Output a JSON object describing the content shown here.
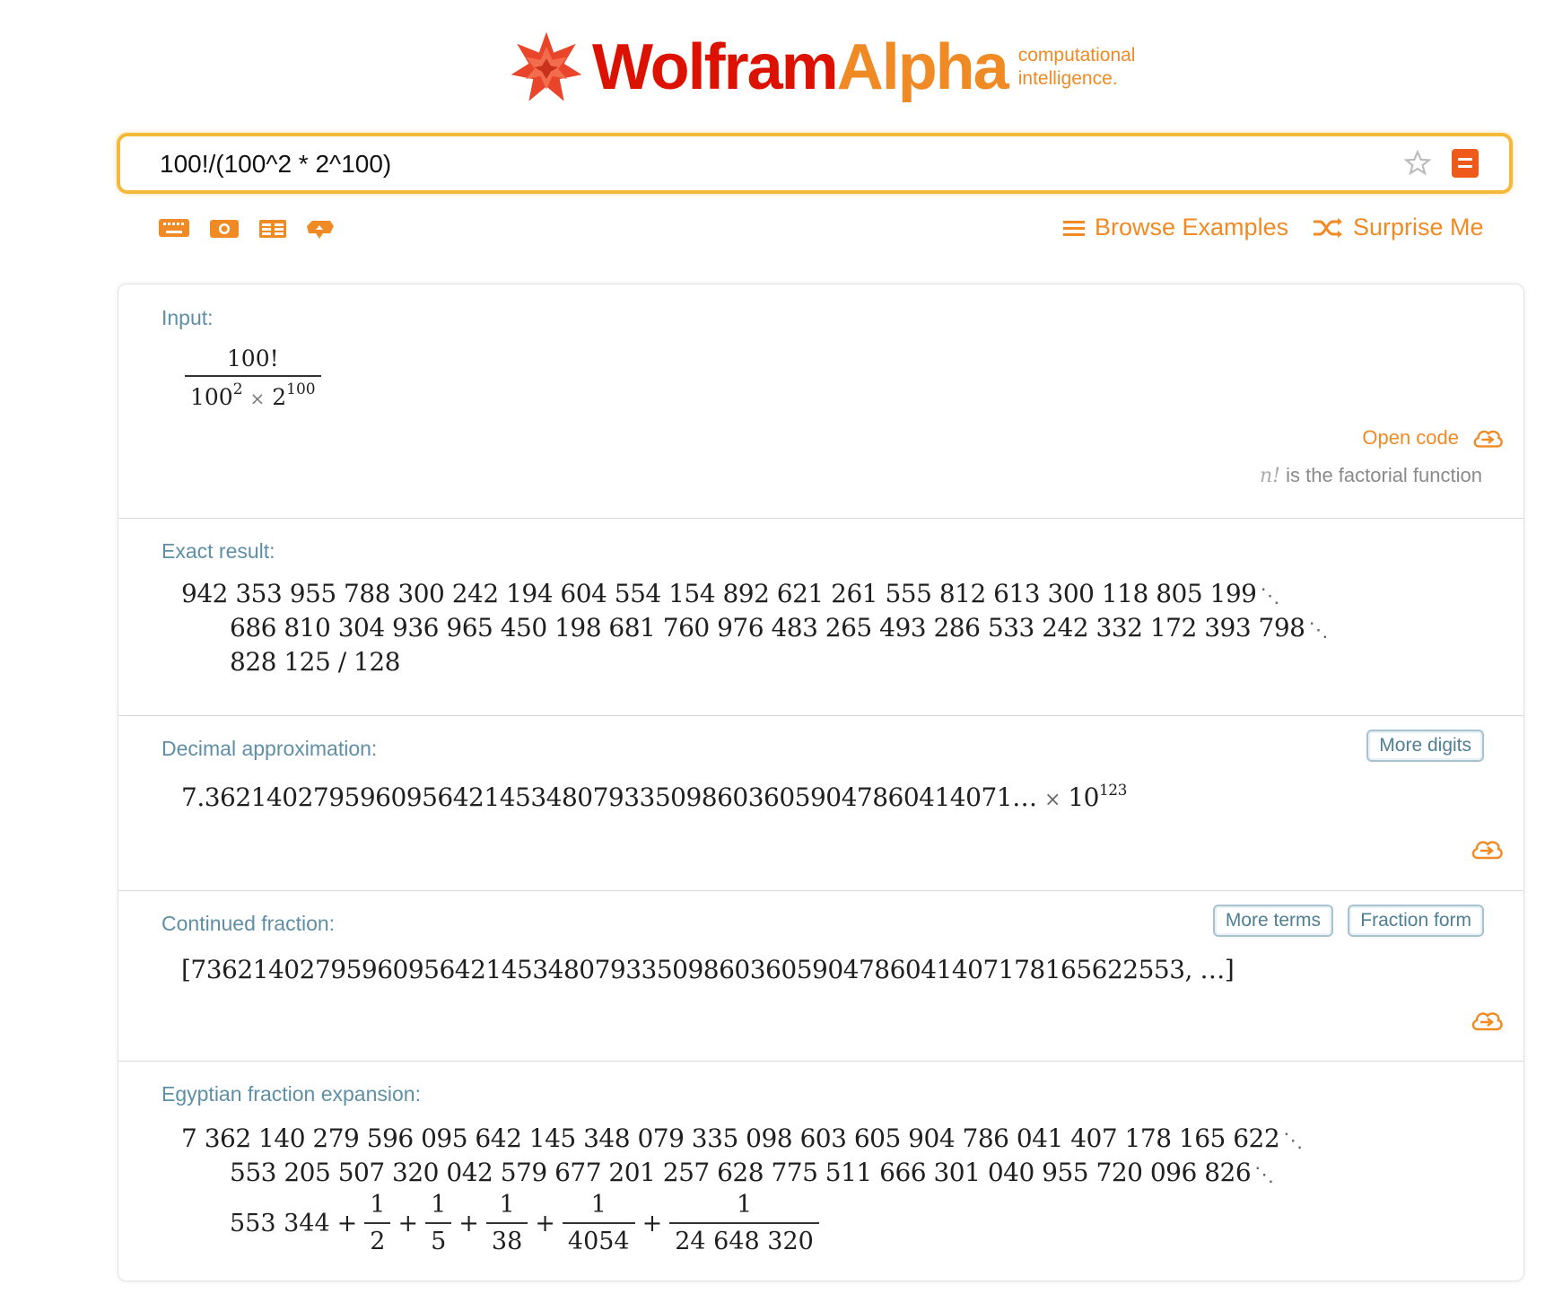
{
  "logo": {
    "wolfram": "Wolfram",
    "alpha": "Alpha",
    "sub1": "computational",
    "sub2": "intelligence."
  },
  "search": {
    "value": "100!/(100^2 * 2^100)"
  },
  "nav": {
    "browse": "Browse Examples",
    "surprise": "Surprise Me"
  },
  "input_pod": {
    "title": "Input:",
    "numerator": "100!",
    "den_base1": "100",
    "den_exp1": "2",
    "den_times": "×",
    "den_base2": "2",
    "den_exp2": "100",
    "open_code": "Open code",
    "note_var": "n!",
    "note_text": " is the factorial function"
  },
  "exact_pod": {
    "title": "Exact result:",
    "line1": "942 353 955 788 300 242 194 604 554 154 892 621 261 555 812 613 300 118 805 199",
    "line2": "686 810 304 936 965 450 198 681 760 976 483 265 493 286 533 242 332 172 393 798",
    "line3": "828 125 / 128"
  },
  "decimal_pod": {
    "title": "Decimal approximation:",
    "button": "More digits",
    "mantissa": "7.3621402795960956421453480793350986036059047860414071…",
    "times": "×",
    "base": "10",
    "exponent": "123"
  },
  "cf_pod": {
    "title": "Continued fraction:",
    "btn_terms": "More terms",
    "btn_fraction": "Fraction form",
    "value": "[7362140279596095642145348079335098603605904786041407178165622553, …]"
  },
  "egypt_pod": {
    "title": "Egyptian fraction expansion:",
    "line1": "7 362 140 279 596 095 642 145 348 079 335 098 603 605 904 786 041 407 178 165 622",
    "line2": "553 205 507 320 042 579 677 201 257 628 775 511 666 301 040 955 720 096 826",
    "lead": "553 344",
    "plus": "+",
    "fractions": [
      {
        "num": "1",
        "den": "2"
      },
      {
        "num": "1",
        "den": "5"
      },
      {
        "num": "1",
        "den": "38"
      },
      {
        "num": "1",
        "den": "4054"
      },
      {
        "num": "1",
        "den": "24 648 320"
      }
    ]
  },
  "colors": {
    "brand_red": "#dd1100",
    "brand_orange": "#f08a24",
    "pod_title": "#5f8fa4",
    "search_border": "#f5b93a"
  },
  "icons": [
    "wolfram-spikey-icon",
    "star-icon",
    "go-button-icon",
    "keyboard-icon",
    "camera-icon",
    "table-icon",
    "cloud-upload-icon",
    "menu-icon",
    "shuffle-icon",
    "cloud-arrow-icon"
  ]
}
